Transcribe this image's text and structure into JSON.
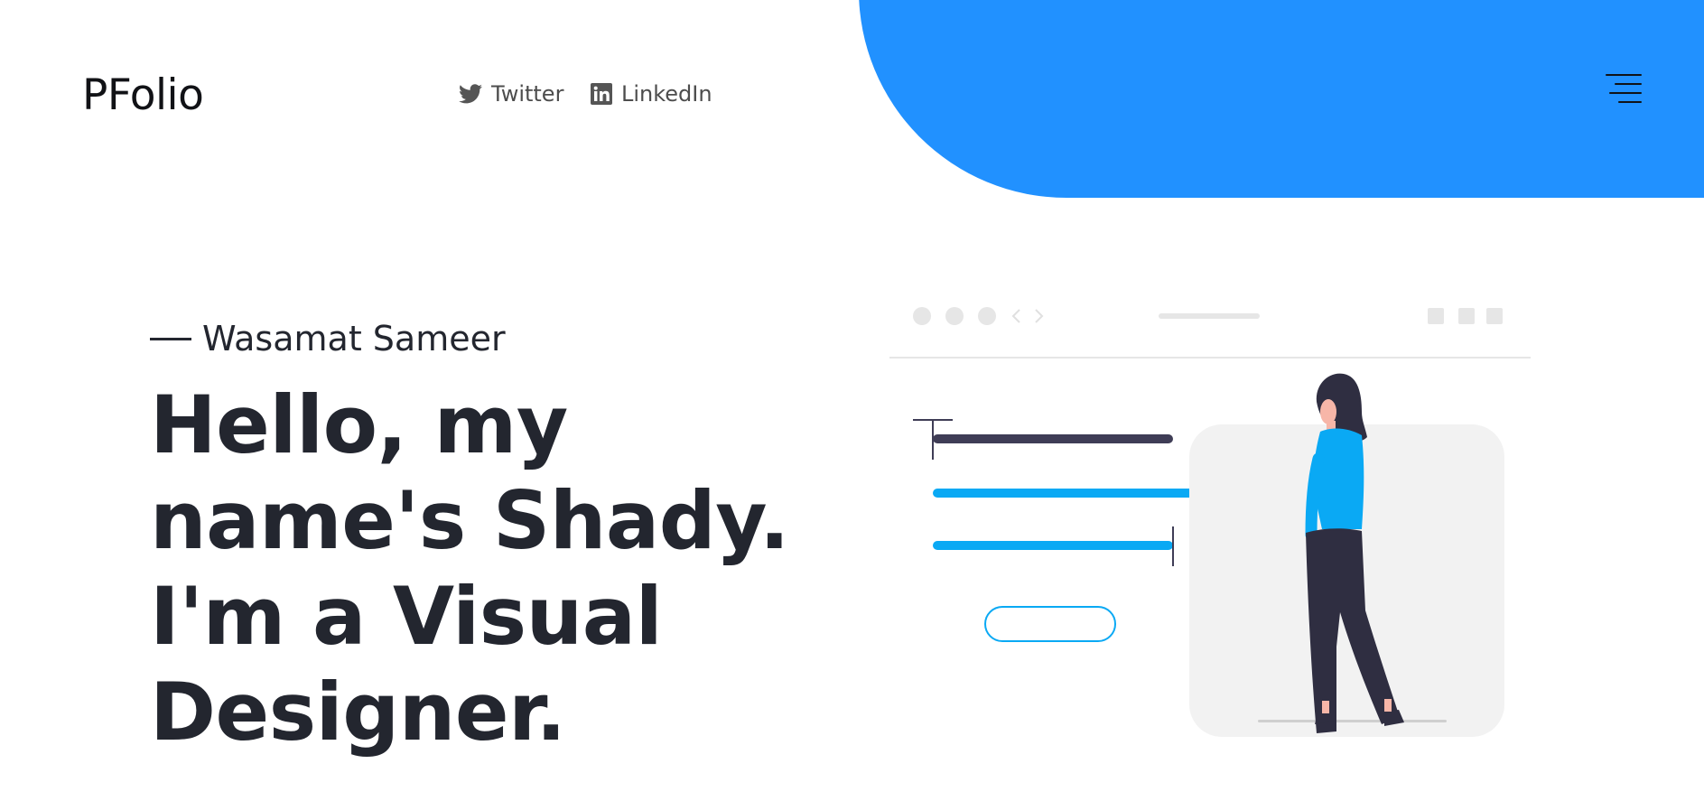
{
  "header": {
    "logo": "PFolio",
    "social_links": [
      {
        "label": "Twitter",
        "icon": "twitter-icon"
      },
      {
        "label": "LinkedIn",
        "icon": "linkedin-icon"
      }
    ],
    "menu_icon": "hamburger-menu-icon"
  },
  "hero": {
    "kicker": "Wasamat Sameer",
    "title_lines": [
      "Hello, my",
      "name's Shady.",
      "I'm a Visual",
      "Designer."
    ]
  },
  "colors": {
    "accent": "#2191ff",
    "illustration_accent": "#0aa9f4",
    "text": "#23262f"
  }
}
